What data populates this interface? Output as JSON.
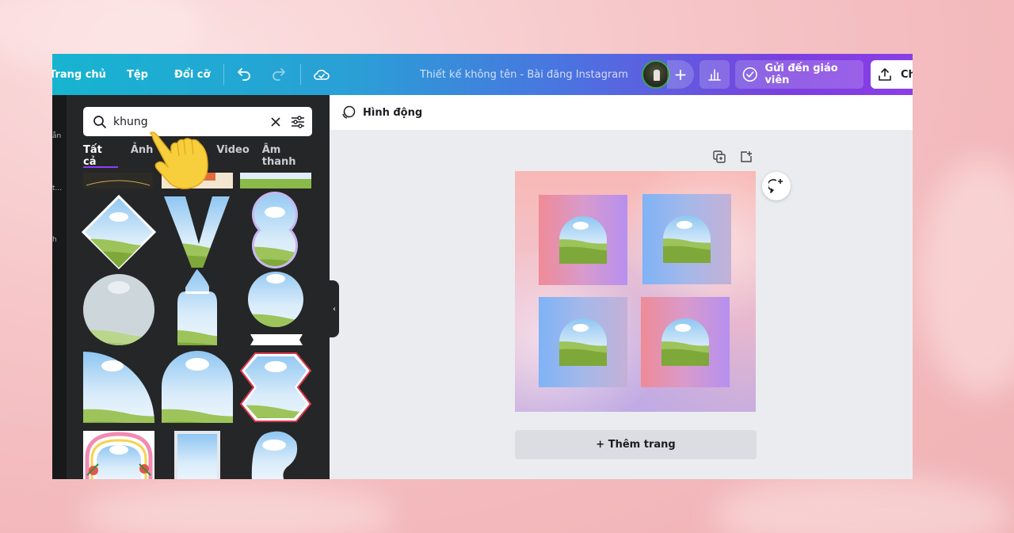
{
  "topbar": {
    "home_label": "Trang chủ",
    "file_label": "Tệp",
    "resize_label": "Đổi cỡ",
    "design_title": "Thiết kế không tên - Bài đăng Instagram",
    "add_label": "+",
    "send_label": "Gửi đến giáo viên",
    "share_label": "Ch",
    "icons": [
      "undo-icon",
      "redo-icon",
      "cloud-saved-icon",
      "bar-chart-icon",
      "check-circle-icon",
      "share-icon"
    ]
  },
  "rail": {
    "items": [
      "ẫn",
      "t...",
      "h"
    ]
  },
  "panel": {
    "search": {
      "value": "khung",
      "placeholder": ""
    },
    "tabs": [
      "Tất cả",
      "Ảnh",
      "Video",
      "Âm thanh"
    ],
    "active_tab": "Tất cả",
    "collapse_label": "‹"
  },
  "canvas": {
    "animate_label": "Hình động",
    "add_page_label": "+ Thêm trang"
  },
  "colors": {
    "accent": "#8b3dff",
    "topbar_start": "#17b4d0",
    "topbar_end": "#8b3ee6",
    "panel_bg": "#252627"
  }
}
